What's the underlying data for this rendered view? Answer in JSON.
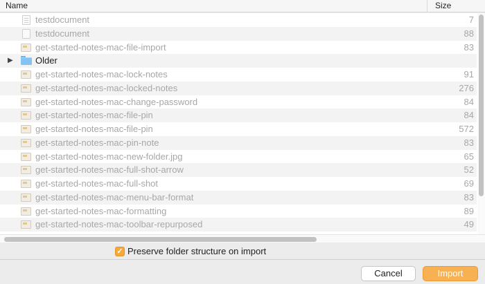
{
  "header": {
    "name_col": "Name",
    "size_col": "Size"
  },
  "rows": [
    {
      "name": "testdocument",
      "size": "7",
      "icon": "document-icon",
      "kind": "doc"
    },
    {
      "name": "testdocument",
      "size": "88",
      "icon": "document-icon",
      "kind": "plain"
    },
    {
      "name": "get-started-notes-mac-file-import",
      "size": "83",
      "icon": "image-file-icon",
      "kind": "img"
    },
    {
      "name": "Older",
      "size": "",
      "icon": "folder-icon",
      "kind": "folder"
    },
    {
      "name": "get-started-notes-mac-lock-notes",
      "size": "91",
      "icon": "image-file-icon",
      "kind": "img"
    },
    {
      "name": "get-started-notes-mac-locked-notes",
      "size": "276",
      "icon": "image-file-icon",
      "kind": "img"
    },
    {
      "name": "get-started-notes-mac-change-password",
      "size": "84",
      "icon": "image-file-icon",
      "kind": "img"
    },
    {
      "name": "get-started-notes-mac-file-pin",
      "size": "84",
      "icon": "image-file-icon",
      "kind": "img"
    },
    {
      "name": "get-started-notes-mac-file-pin",
      "size": "572",
      "icon": "image-file-icon",
      "kind": "img"
    },
    {
      "name": "get-started-notes-mac-pin-note",
      "size": "83",
      "icon": "image-file-icon",
      "kind": "img"
    },
    {
      "name": "get-started-notes-mac-new-folder.jpg",
      "size": "65",
      "icon": "image-file-icon",
      "kind": "img"
    },
    {
      "name": "get-started-notes-mac-full-shot-arrow",
      "size": "52",
      "icon": "image-file-icon",
      "kind": "img"
    },
    {
      "name": "get-started-notes-mac-full-shot",
      "size": "69",
      "icon": "image-file-icon",
      "kind": "img"
    },
    {
      "name": "get-started-notes-mac-menu-bar-format",
      "size": "83",
      "icon": "image-file-icon",
      "kind": "img"
    },
    {
      "name": "get-started-notes-mac-formatting",
      "size": "89",
      "icon": "image-file-icon",
      "kind": "img"
    },
    {
      "name": "get-started-notes-mac-toolbar-repurposed",
      "size": "49",
      "icon": "image-file-icon",
      "kind": "img"
    }
  ],
  "preserve": {
    "label": "Preserve folder structure on import",
    "checked": true
  },
  "buttons": {
    "cancel": "Cancel",
    "import": "Import"
  },
  "colors": {
    "accent": "#f7b052",
    "checkbox": "#f6a83a"
  }
}
